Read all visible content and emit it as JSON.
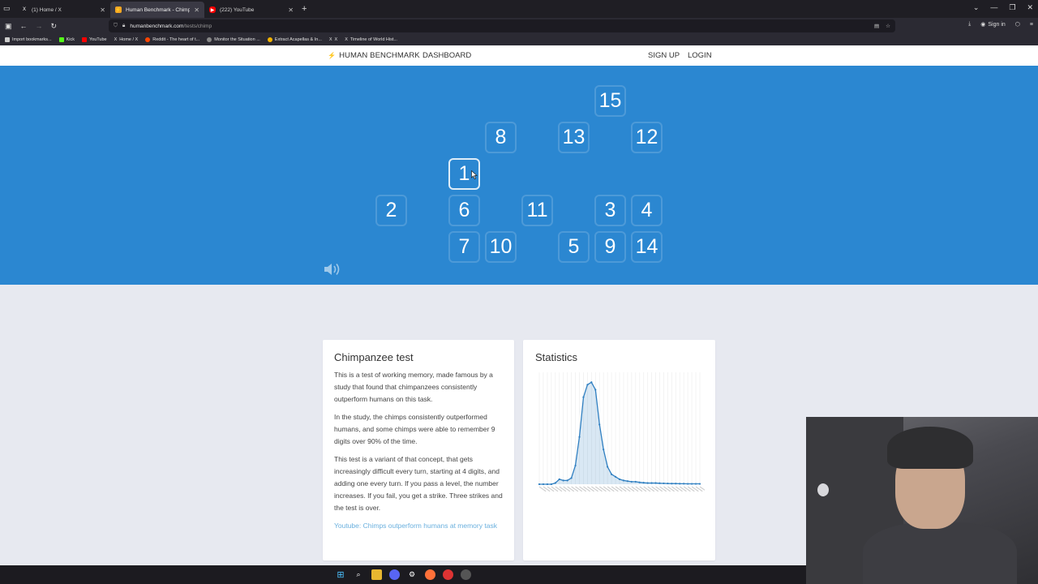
{
  "browser": {
    "tabs": [
      {
        "label": "(1) Home / X",
        "icon": "x-logo-icon",
        "active": false
      },
      {
        "label": "Human Benchmark - Chimp Te",
        "icon": "human-benchmark-favicon",
        "active": true
      },
      {
        "label": "(222) YouTube",
        "icon": "youtube-icon",
        "active": false
      }
    ],
    "url_host": "humanbenchmark.com",
    "url_path": "/tests/chimp",
    "signin_label": "Sign in",
    "bookmarks": [
      {
        "label": "Import bookmarks...",
        "color": "#cccccc"
      },
      {
        "label": "Kick",
        "color": "#53fc18"
      },
      {
        "label": "YouTube",
        "color": "#ff0000"
      },
      {
        "label": "Home / X",
        "color": "#ffffff"
      },
      {
        "label": "Reddit - The heart of t...",
        "color": "#ff4500"
      },
      {
        "label": "Monitor the Situation ...",
        "color": "#888888"
      },
      {
        "label": "Extract Acapellas & In...",
        "color": "#f5b400"
      },
      {
        "label": "X",
        "color": "#ffffff"
      },
      {
        "label": "Timeline of World Hist...",
        "color": "#ffffff"
      }
    ]
  },
  "site": {
    "logo": "HUMAN BENCHMARK",
    "dashboard": "DASHBOARD",
    "signup": "SIGN UP",
    "login": "LOGIN"
  },
  "game": {
    "background": "#2b87d1",
    "numbers": [
      "15",
      "8",
      "13",
      "12",
      "1",
      "2",
      "6",
      "11",
      "3",
      "4",
      "7",
      "10",
      "5",
      "9",
      "14"
    ]
  },
  "info_card": {
    "title": "Chimpanzee test",
    "p1": "This is a test of working memory, made famous by a study that found that chimpanzees consistently outperform humans on this task.",
    "p2": "In the study, the chimps consistently outperformed humans, and some chimps were able to remember 9 digits over 90% of the time.",
    "p3": "This test is a variant of that concept, that gets increasingly difficult every turn, starting at 4 digits, and adding one every turn. If you pass a level, the number increases. If you fail, you get a strike. Three strikes and the test is over.",
    "link": "Youtube: Chimps outperform humans at memory task"
  },
  "stats_card": {
    "title": "Statistics"
  },
  "chart_data": {
    "type": "area",
    "x": [
      1,
      2,
      3,
      4,
      5,
      6,
      7,
      8,
      9,
      10,
      11,
      12,
      13,
      14,
      15,
      16,
      17,
      18,
      19,
      20,
      21,
      22,
      23,
      24,
      25,
      26,
      27,
      28,
      29,
      30,
      31,
      32,
      33,
      34,
      35,
      36,
      37,
      38,
      39,
      40,
      41
    ],
    "values": [
      0,
      0,
      0,
      0,
      1,
      4,
      3,
      3,
      5,
      15,
      38,
      70,
      80,
      82,
      76,
      48,
      28,
      14,
      8,
      6,
      4,
      3,
      2.5,
      2,
      2,
      1.5,
      1.2,
      1,
      1,
      1,
      0.8,
      0.7,
      0.6,
      0.5,
      0.5,
      0.4,
      0.4,
      0.3,
      0.3,
      0.3,
      0.3
    ],
    "ylim": [
      0,
      90
    ],
    "grid": true,
    "color": "#2f7fc1"
  }
}
